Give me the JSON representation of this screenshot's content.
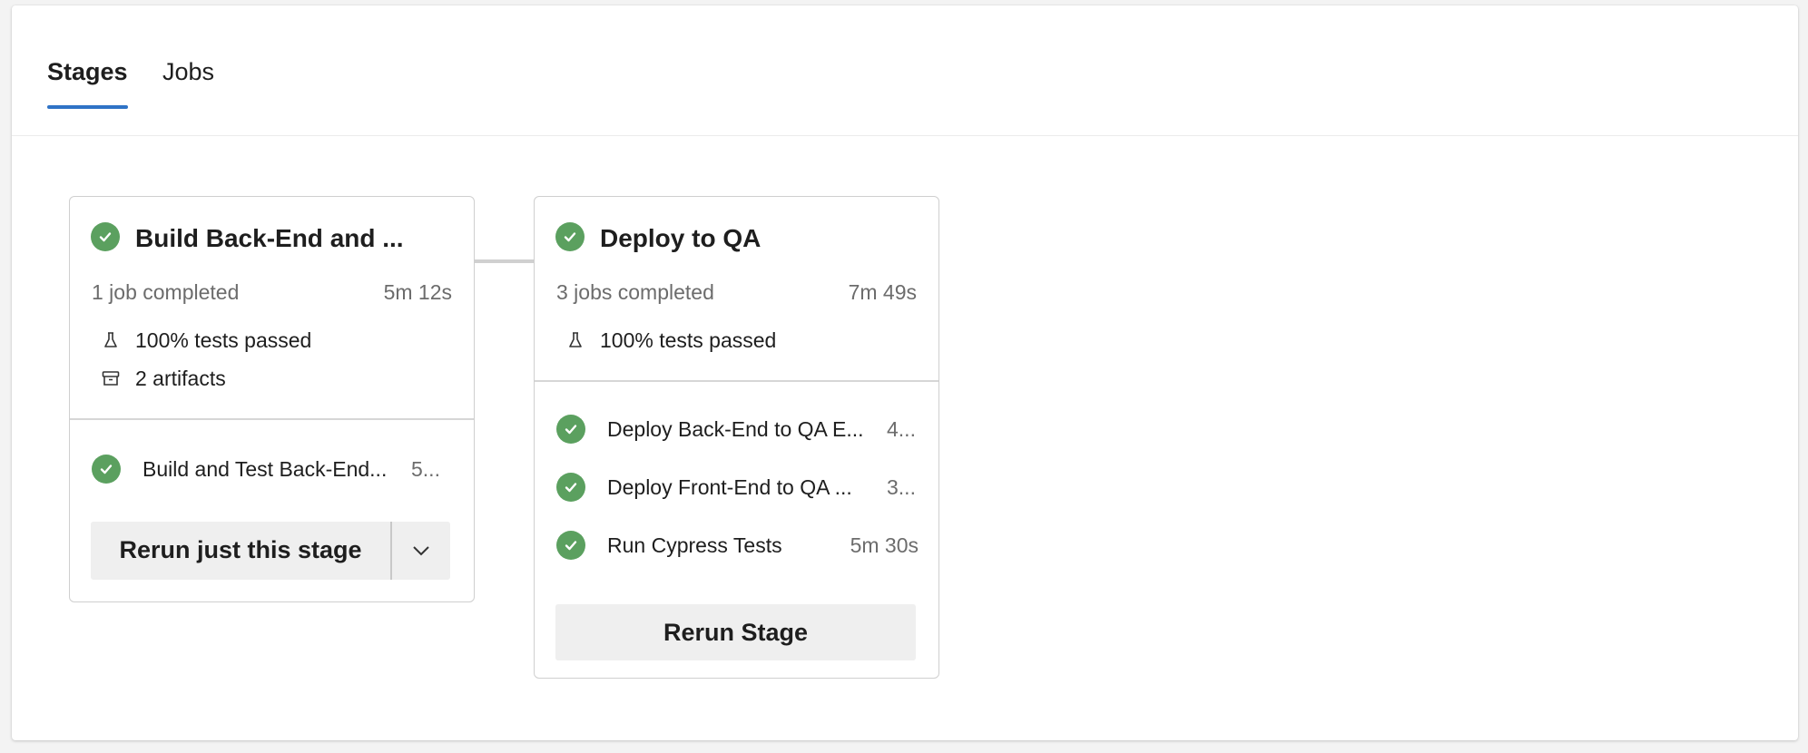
{
  "tabs": [
    {
      "label": "Stages",
      "active": true
    },
    {
      "label": "Jobs",
      "active": false
    }
  ],
  "colors": {
    "accent": "#2f73c6",
    "success": "#5ba05f",
    "muted_text": "#6c6c6c",
    "button_bg": "#efefef"
  },
  "stages": [
    {
      "title": "Build Back-End and ...",
      "status": "succeeded",
      "status_icon": "check-circle-icon",
      "jobs_summary": "1 job completed",
      "duration": "5m 12s",
      "tests": {
        "icon": "flask-icon",
        "label": "100% tests passed"
      },
      "artifacts": {
        "icon": "archive-box-icon",
        "label": "2 artifacts"
      },
      "jobs": [
        {
          "name": "Build and Test Back-End...",
          "duration": "5...",
          "status": "succeeded"
        }
      ],
      "action": {
        "label": "Rerun just this stage",
        "dropdown_icon": "chevron-down-icon"
      }
    },
    {
      "title": "Deploy to QA",
      "status": "succeeded",
      "status_icon": "check-circle-icon",
      "jobs_summary": "3 jobs completed",
      "duration": "7m 49s",
      "tests": {
        "icon": "flask-icon",
        "label": "100% tests passed"
      },
      "jobs": [
        {
          "name": "Deploy Back-End to QA E...",
          "duration": "4...",
          "status": "succeeded"
        },
        {
          "name": "Deploy Front-End to QA ...",
          "duration": "3...",
          "status": "succeeded"
        },
        {
          "name": "Run Cypress Tests",
          "duration": "5m 30s",
          "status": "succeeded"
        }
      ],
      "action": {
        "label": "Rerun Stage"
      }
    }
  ]
}
